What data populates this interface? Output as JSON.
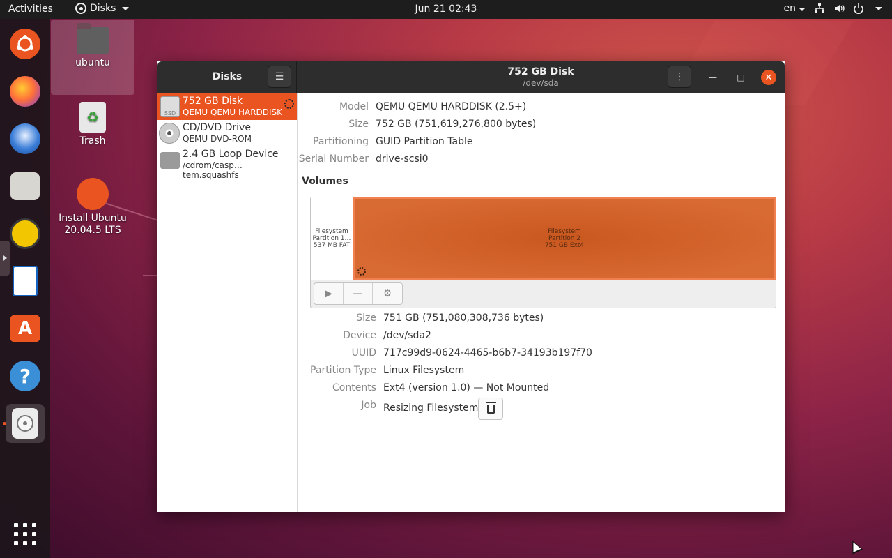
{
  "topbar": {
    "activities": "Activities",
    "app_name": "Disks",
    "clock": "Jun 21  02:43",
    "language": "en"
  },
  "desktop": {
    "items": [
      {
        "label": "ubuntu"
      },
      {
        "label": "Trash"
      },
      {
        "label": "Install Ubuntu 20.04.5 LTS"
      }
    ]
  },
  "window": {
    "sidebar_title": "Disks",
    "title": "752 GB Disk",
    "subtitle": "/dev/sda",
    "drives": [
      {
        "name": "752 GB Disk",
        "sub": "QEMU QEMU HARDDISK",
        "badge": "SSD"
      },
      {
        "name": "CD/DVD Drive",
        "sub": "QEMU DVD-ROM"
      },
      {
        "name": "2.4 GB Loop Device",
        "sub": "/cdrom/casp…tem.squashfs"
      }
    ],
    "disk_props": [
      {
        "key": "Model",
        "value": "QEMU QEMU HARDDISK (2.5+)"
      },
      {
        "key": "Size",
        "value": "752 GB (751,619,276,800 bytes)"
      },
      {
        "key": "Partitioning",
        "value": "GUID Partition Table"
      },
      {
        "key": "Serial Number",
        "value": "drive-scsi0"
      }
    ],
    "volumes_heading": "Volumes",
    "partitions": [
      {
        "line1": "Filesystem",
        "line2": "Partition 1…",
        "line3": "537 MB FAT"
      },
      {
        "line1": "Filesystem",
        "line2": "Partition 2",
        "line3": "751 GB Ext4"
      }
    ],
    "volume_props": [
      {
        "key": "Size",
        "value": "751 GB (751,080,308,736 bytes)"
      },
      {
        "key": "Device",
        "value": "/dev/sda2"
      },
      {
        "key": "UUID",
        "value": "717c99d9-0624-4465-b6b7-34193b197f70"
      },
      {
        "key": "Partition Type",
        "value": "Linux Filesystem"
      },
      {
        "key": "Contents",
        "value": "Ext4 (version 1.0) — Not Mounted"
      },
      {
        "key": "Job",
        "value": "Resizing Filesystem"
      }
    ]
  }
}
